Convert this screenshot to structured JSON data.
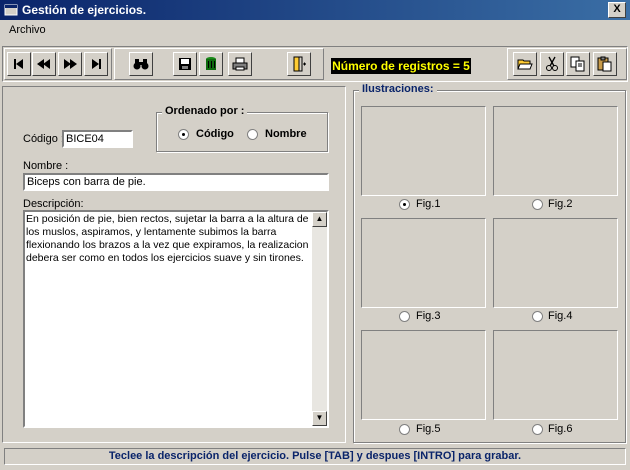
{
  "window": {
    "title": "Gestión de ejercicios.",
    "close_label": "X"
  },
  "menu": {
    "archivo_label": "Archivo"
  },
  "toolbar": {
    "record_count": "Número de registros = 5",
    "icons": [
      "first-record-icon",
      "prev-record-icon",
      "next-record-icon",
      "last-record-icon",
      "binoculars-icon",
      "save-disk-icon",
      "delete-bin-icon",
      "print-icon",
      "exit-door-icon",
      "open-folder-icon",
      "cut-scissors-icon",
      "copy-icon",
      "paste-icon"
    ]
  },
  "form": {
    "codigo_label": "Código :",
    "codigo_value": "BICE04",
    "sort_group_label": "Ordenado por :",
    "sort_codigo_label": "Código",
    "sort_nombre_label": "Nombre",
    "sort_selected": "Código",
    "nombre_label": "Nombre :",
    "nombre_value": "Biceps con barra de pie.",
    "descripcion_label": "Descripción:",
    "descripcion_value": "En posición de pie, bien rectos, sujetar la  barra a la altura de los muslos, aspiramos, y lentamente subimos la barra flexionando los brazos a la vez que expiramos, la realizacion debera ser como en todos los ejercicios suave y sin tirones."
  },
  "illustrations": {
    "group_label": "Ilustraciones:",
    "figures": [
      "Fig.1",
      "Fig.2",
      "Fig.3",
      "Fig.4",
      "Fig.5",
      "Fig.6"
    ],
    "selected": "Fig.1"
  },
  "status": {
    "message": "Teclee la descripción del ejercicio. Pulse [TAB] y despues [INTRO] para grabar."
  },
  "colors": {
    "title_bar": "#0a246a",
    "record_count_bg": "#000000",
    "record_count_fg": "#ffff00",
    "status_text": "#0a246a"
  }
}
